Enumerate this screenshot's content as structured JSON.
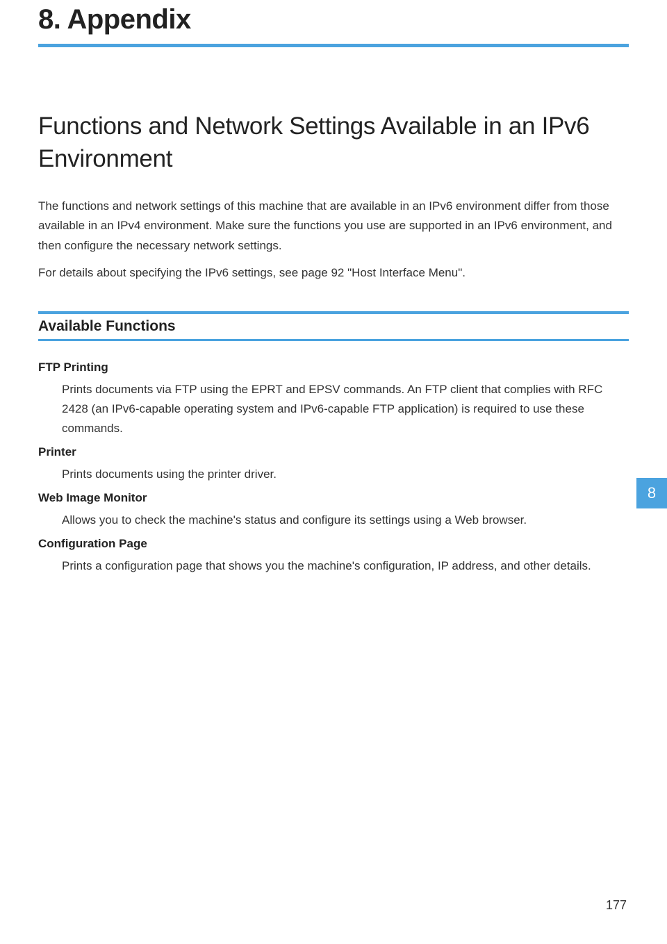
{
  "chapter": {
    "title": "8. Appendix"
  },
  "section": {
    "title": "Functions and Network Settings Available in an IPv6 Environment",
    "intro1": "The functions and network settings of this machine that are available in an IPv6 environment differ from those available in an IPv4 environment. Make sure the functions you use are supported in an IPv6 environment, and then configure the necessary network settings.",
    "intro2": "For details about specifying the IPv6 settings, see page 92 \"Host Interface Menu\"."
  },
  "subsection": {
    "title": "Available Functions"
  },
  "functions": [
    {
      "term": "FTP Printing",
      "definition": "Prints documents via FTP using the EPRT and EPSV commands. An FTP client that complies with RFC 2428 (an IPv6-capable operating system and IPv6-capable FTP application) is required to use these commands."
    },
    {
      "term": "Printer",
      "definition": "Prints documents using the printer driver."
    },
    {
      "term": "Web Image Monitor",
      "definition": "Allows you to check the machine's status and configure its settings using a Web browser."
    },
    {
      "term": "Configuration Page",
      "definition": "Prints a configuration page that shows you the machine's configuration, IP address, and other details."
    }
  ],
  "sideTab": "8",
  "pageNumber": "177"
}
